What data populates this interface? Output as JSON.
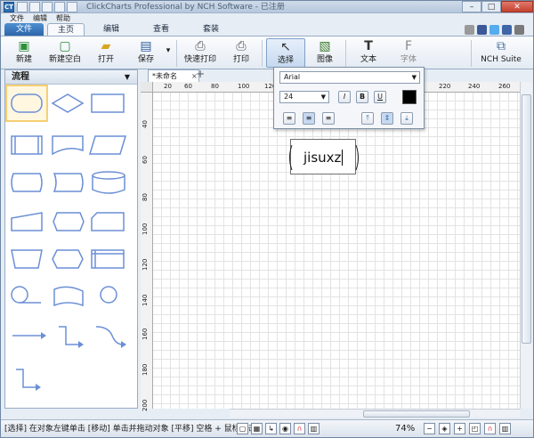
{
  "window": {
    "title": "ClickCharts Professional by NCH Software - 已注册",
    "minimize": "–",
    "maximize": "□",
    "close": "✕"
  },
  "menu": [
    "文件",
    "编辑",
    "帮助"
  ],
  "ribbon_tabs": {
    "file": "文件",
    "home": "主页",
    "edit": "编辑",
    "view": "查看",
    "suite": "套装"
  },
  "ribbon": {
    "new": "新建",
    "new_blank": "新建空白",
    "open": "打开",
    "save": "保存",
    "quick_print": "快速打印",
    "print": "打印",
    "select": "选择",
    "image": "图像",
    "text": "文本",
    "font": "字体",
    "nch_suite": "NCH Suite"
  },
  "shape_panel": {
    "title": "流程"
  },
  "document_tab": {
    "label": "*未命名",
    "close": "×",
    "add": "+"
  },
  "ruler_h": [
    [
      "20",
      12
    ],
    [
      "60",
      35
    ],
    [
      "80",
      65
    ],
    [
      "100",
      95
    ],
    [
      "120",
      125
    ],
    [
      "220",
      321
    ],
    [
      "240",
      354
    ],
    [
      "260",
      388
    ]
  ],
  "ruler_v": [
    [
      "40",
      30
    ],
    [
      "60",
      70
    ],
    [
      "80",
      112
    ],
    [
      "100",
      150
    ],
    [
      "120",
      190
    ],
    [
      "140",
      230
    ],
    [
      "160",
      268
    ],
    [
      "180",
      308
    ],
    [
      "200",
      348
    ]
  ],
  "canvas_text": "jisuxz",
  "font_popup": {
    "family": "Arial",
    "size": "24",
    "italic": "I",
    "bold": "B",
    "underline": "U",
    "color": "#000000"
  },
  "status": {
    "text": "[选择] 在对象左键单击 [移动] 单击并拖动对象 [平移] 空格 + 鼠标单击",
    "zoom": "74%",
    "zoom_out": "−",
    "zoom_in": "+"
  },
  "colors": {
    "accent": "#2d66a9",
    "shape_stroke": "#6b8fd6",
    "selection": "#f3c14a"
  }
}
